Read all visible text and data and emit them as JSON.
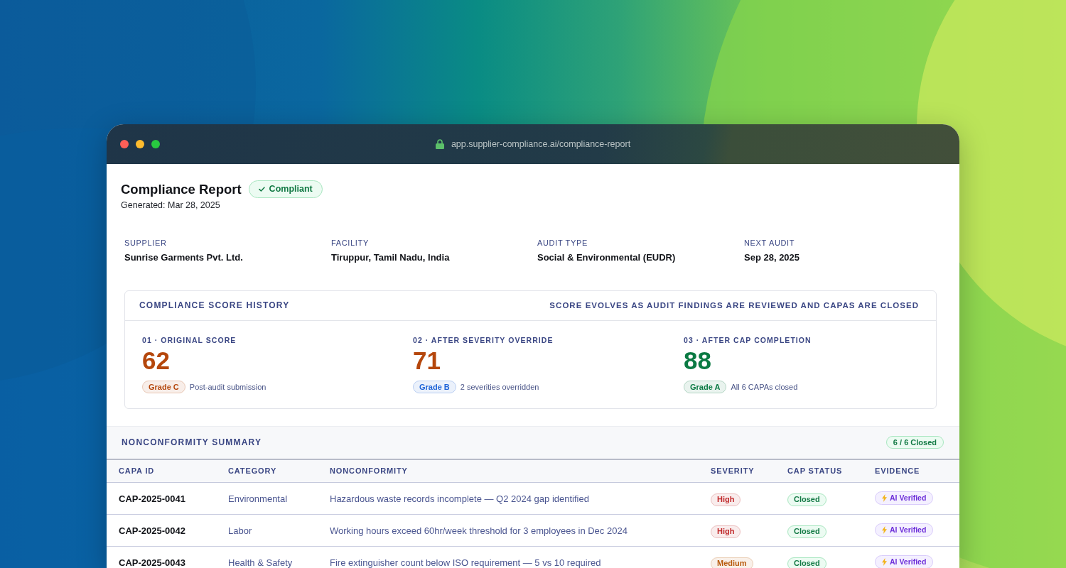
{
  "browser": {
    "url": "app.supplier-compliance.ai/compliance-report"
  },
  "report": {
    "title": "Compliance Report",
    "status_badge": "Compliant",
    "generated": "Generated: Mar 28, 2025"
  },
  "details": [
    {
      "label": "SUPPLIER",
      "value": "Sunrise Garments Pvt. Ltd."
    },
    {
      "label": "FACILITY",
      "value": "Tiruppur, Tamil Nadu, India"
    },
    {
      "label": "AUDIT TYPE",
      "value": "Social & Environmental (EUDR)"
    },
    {
      "label": "NEXT AUDIT",
      "value": "Sep 28, 2025"
    }
  ],
  "score_history": {
    "title": "COMPLIANCE SCORE HISTORY",
    "subtitle": "SCORE EVOLVES AS AUDIT FINDINGS ARE REVIEWED AND CAPAS ARE CLOSED",
    "stages": [
      {
        "label": "01 · ORIGINAL SCORE",
        "score": "62",
        "color": "#b5470c",
        "grade": {
          "label": "Grade C",
          "color": "#b5470c"
        },
        "note": "Post-audit submission"
      },
      {
        "label": "02 · AFTER SEVERITY OVERRIDE",
        "score": "71",
        "color": "#b5470c",
        "grade": {
          "label": "Grade B",
          "color": "#1d63d8"
        },
        "note": "2 severities overridden"
      },
      {
        "label": "03 · AFTER CAP COMPLETION",
        "score": "88",
        "color": "#0b7a43",
        "grade": {
          "label": "Grade A",
          "color": "#0b7a43"
        },
        "note": "All 6 CAPAs closed"
      }
    ]
  },
  "nonconformity_summary": {
    "title": "NONCONFORMITY SUMMARY",
    "closed_badge": "6 / 6 Closed",
    "columns": [
      "CAPA ID",
      "CATEGORY",
      "NONCONFORMITY",
      "SEVERITY",
      "CAP STATUS",
      "EVIDENCE"
    ],
    "rows": [
      {
        "capa_id": "CAP-2025-0041",
        "category": "Environmental",
        "nonconformity": "Hazardous waste records incomplete — Q2 2024 gap identified",
        "severity": {
          "label": "High",
          "color": "#c0282a"
        },
        "cap_status": "Closed",
        "evidence": "AI Verified"
      },
      {
        "capa_id": "CAP-2025-0042",
        "category": "Labor",
        "nonconformity": "Working hours exceed 60hr/week threshold for 3 employees in Dec 2024",
        "severity": {
          "label": "High",
          "color": "#c0282a"
        },
        "cap_status": "Closed",
        "evidence": "AI Verified"
      },
      {
        "capa_id": "CAP-2025-0043",
        "category": "Health & Safety",
        "nonconformity": "Fire extinguisher count below ISO requirement — 5 vs 10 required",
        "severity": {
          "label": "Medium",
          "color": "#b85a0c"
        },
        "cap_status": "Closed",
        "evidence": "AI Verified"
      }
    ]
  }
}
